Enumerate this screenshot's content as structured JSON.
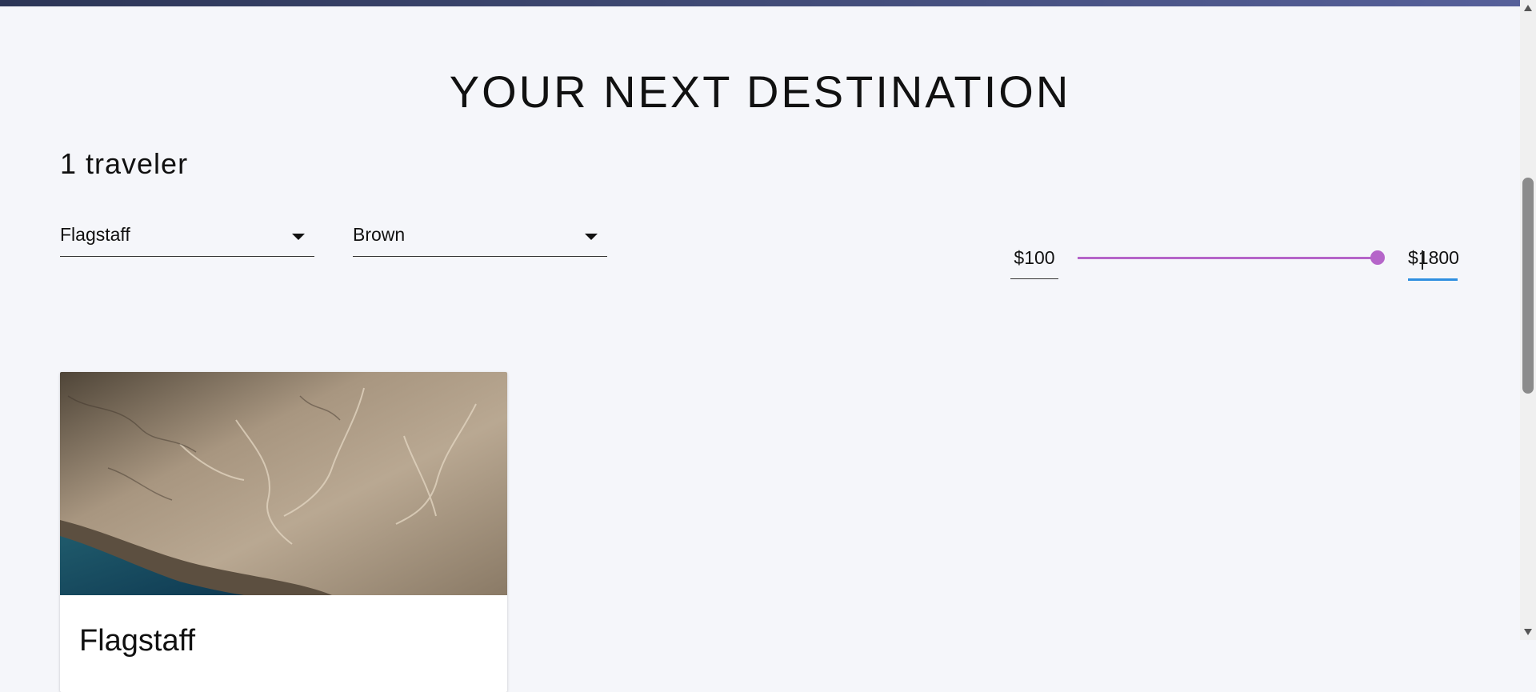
{
  "page": {
    "title": "YOUR NEXT DESTINATION"
  },
  "travelers": {
    "label": "1 traveler"
  },
  "filters": {
    "destination": {
      "selected": "Flagstaff"
    },
    "color": {
      "selected": "Brown"
    }
  },
  "price": {
    "min_value": "$100",
    "max_value": "$1800",
    "slider_fraction": 1.0
  },
  "colors": {
    "accent": "#b565c9",
    "focus_underline": "#2f8fe0",
    "background": "#f5f6fa"
  },
  "cards": [
    {
      "title": "Flagstaff",
      "image": "aerial-desert-coastline-image"
    }
  ]
}
